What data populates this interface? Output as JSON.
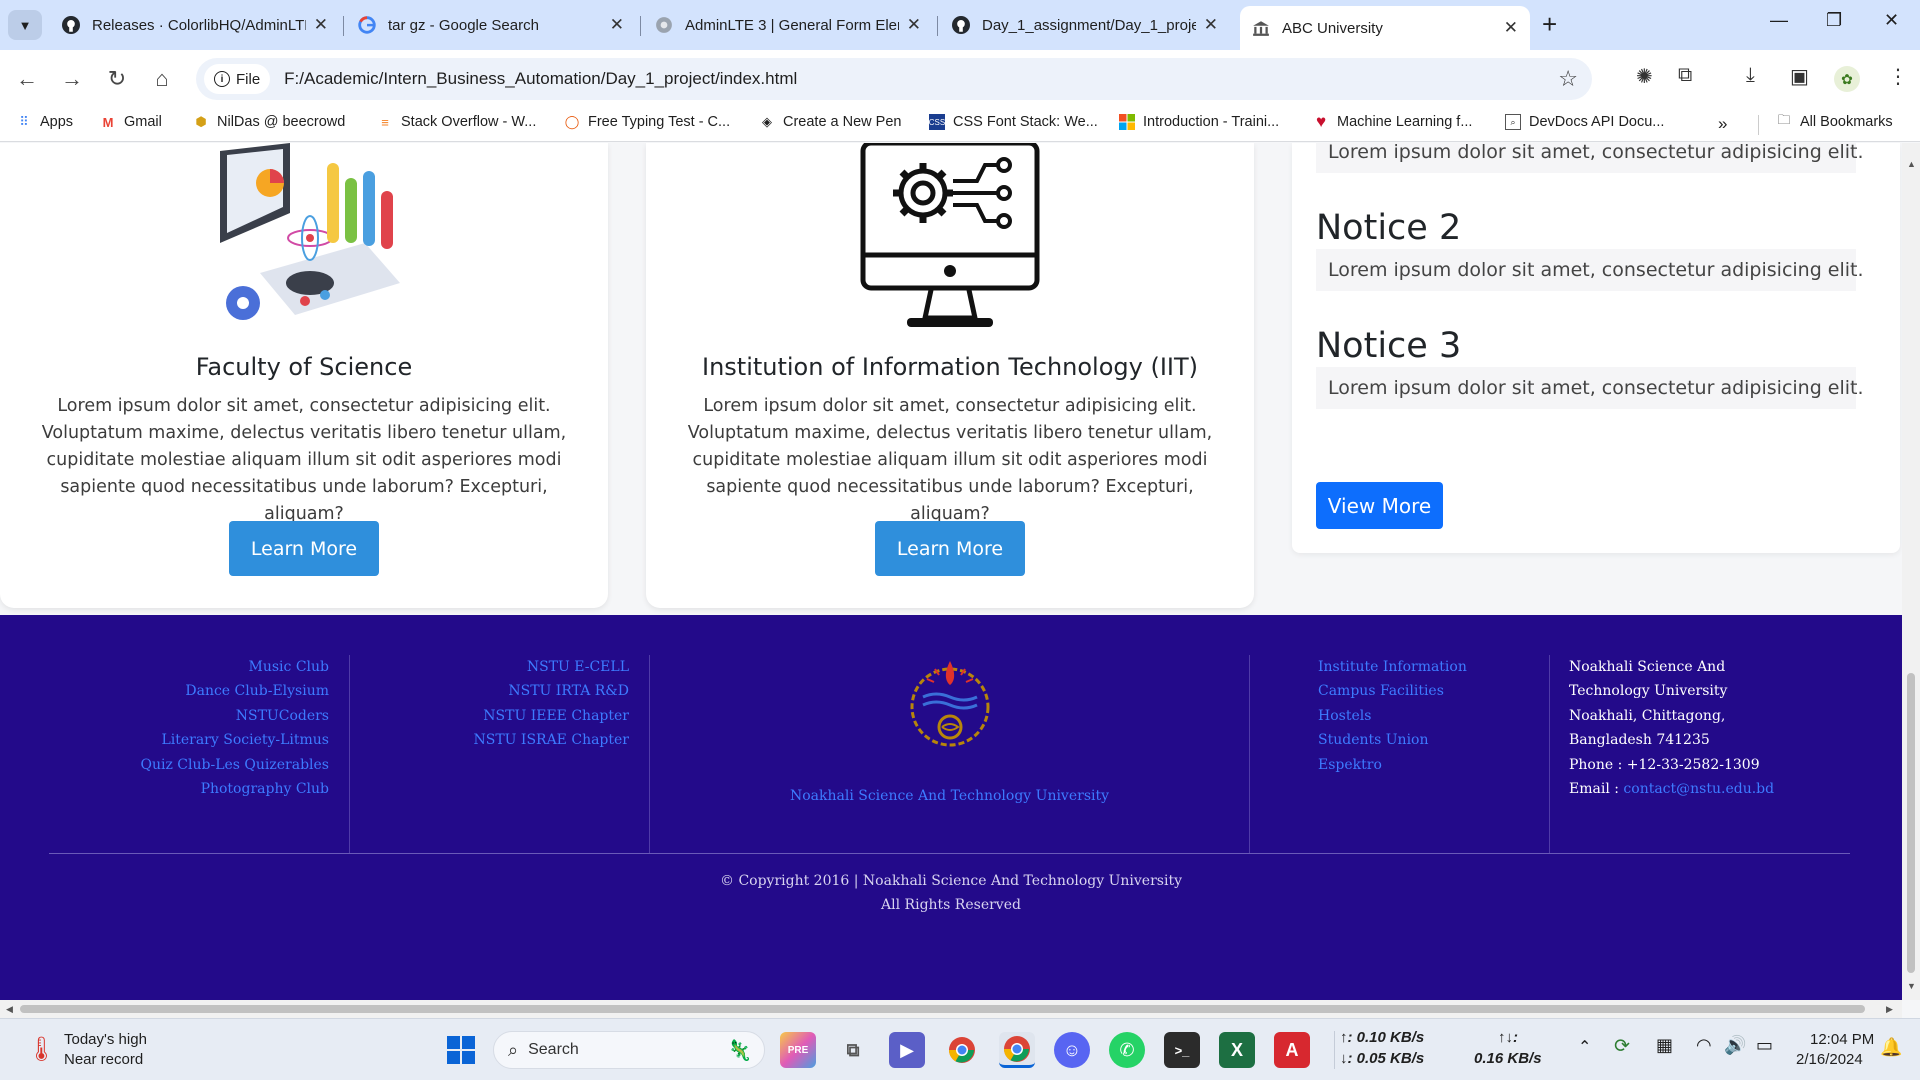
{
  "browser": {
    "tabs": [
      {
        "title": "Releases · ColorlibHQ/AdminLTE",
        "icon": "github-icon"
      },
      {
        "title": "tar gz - Google Search",
        "icon": "google-icon"
      },
      {
        "title": "AdminLTE 3 | General Form Elem",
        "icon": "adminlte-icon"
      },
      {
        "title": "Day_1_assignment/Day_1_proje",
        "icon": "github-icon"
      },
      {
        "title": "ABC University",
        "icon": "university-icon"
      }
    ],
    "omnibox": {
      "scheme_label": "File",
      "url": "F:/Academic/Intern_Business_Automation/Day_1_project/index.html"
    },
    "bookmarks": [
      {
        "label": "Apps"
      },
      {
        "label": "Gmail"
      },
      {
        "label": "NilDas @ beecrowd"
      },
      {
        "label": "Stack Overflow - W..."
      },
      {
        "label": "Free Typing Test - C..."
      },
      {
        "label": "Create a New Pen"
      },
      {
        "label": "CSS Font Stack: We..."
      },
      {
        "label": "Introduction - Traini..."
      },
      {
        "label": "Machine Learning f..."
      },
      {
        "label": "DevDocs API Docu..."
      }
    ],
    "all_bookmarks": "All Bookmarks"
  },
  "page": {
    "cards": [
      {
        "title": "Faculty of Science",
        "text": "Lorem ipsum dolor sit amet, consectetur adipisicing elit. Voluptatum maxime, delectus veritatis libero tenetur ullam, cupiditate molestiae aliquam illum sit odit asperiores modi sapiente quod necessitatibus unde laborum? Excepturi, aliquam?",
        "button": "Learn More"
      },
      {
        "title": "Institution of Information Technology (IIT)",
        "text": "Lorem ipsum dolor sit amet, consectetur adipisicing elit. Voluptatum maxime, delectus veritatis libero tenetur ullam, cupiditate molestiae aliquam illum sit odit asperiores modi sapiente quod necessitatibus unde laborum? Excepturi, aliquam?",
        "button": "Learn More"
      }
    ],
    "notices": {
      "first_body": "Lorem ipsum dolor sit amet, consectetur adipisicing elit.",
      "items": [
        {
          "title": "Notice 2",
          "body": "Lorem ipsum dolor sit amet, consectetur adipisicing elit."
        },
        {
          "title": "Notice 3",
          "body": "Lorem ipsum dolor sit amet, consectetur adipisicing elit."
        }
      ],
      "view_more": "View More"
    },
    "footer": {
      "clubs": [
        "Music Club",
        "Dance Club-Elysium",
        "NSTUCoders",
        "Literary Society-Litmus",
        "Quiz Club-Les Quizerables",
        "Photography Club"
      ],
      "research": [
        "NSTU E-CELL",
        "NSTU IRTA R&D",
        "NSTU IEEE Chapter",
        "NSTU ISRAE Chapter"
      ],
      "logo_caption": "Noakhali Science And Technology University",
      "info_links": [
        "Institute Information",
        "Campus Facilities",
        "Hostels",
        "Students Union",
        "Espektro"
      ],
      "contact": {
        "name": "Noakhali Science And Technology University",
        "address": "Noakhali, Chittagong, Bangladesh 741235",
        "phone_label": "Phone :",
        "phone": "+12-33-2582-1309",
        "email_label": "Email :",
        "email": "contact@nstu.edu.bd"
      },
      "copyright": "© Copyright 2016 | Noakhali Science And Technology University",
      "rights": "All Rights Reserved"
    }
  },
  "taskbar": {
    "weather_line1": "Today's high",
    "weather_line2": "Near record",
    "search_placeholder": "Search",
    "net_up": "0.10 KB/s",
    "net_down": "0.05 KB/s",
    "net_total": "0.16 KB/s",
    "time": "12:04 PM",
    "date": "2/16/2024"
  },
  "colors": {
    "footer_bg": "#230a8a",
    "learn_button": "#2f8fdc",
    "view_more_button": "#0d6efd",
    "footer_link": "#3d7bff"
  }
}
